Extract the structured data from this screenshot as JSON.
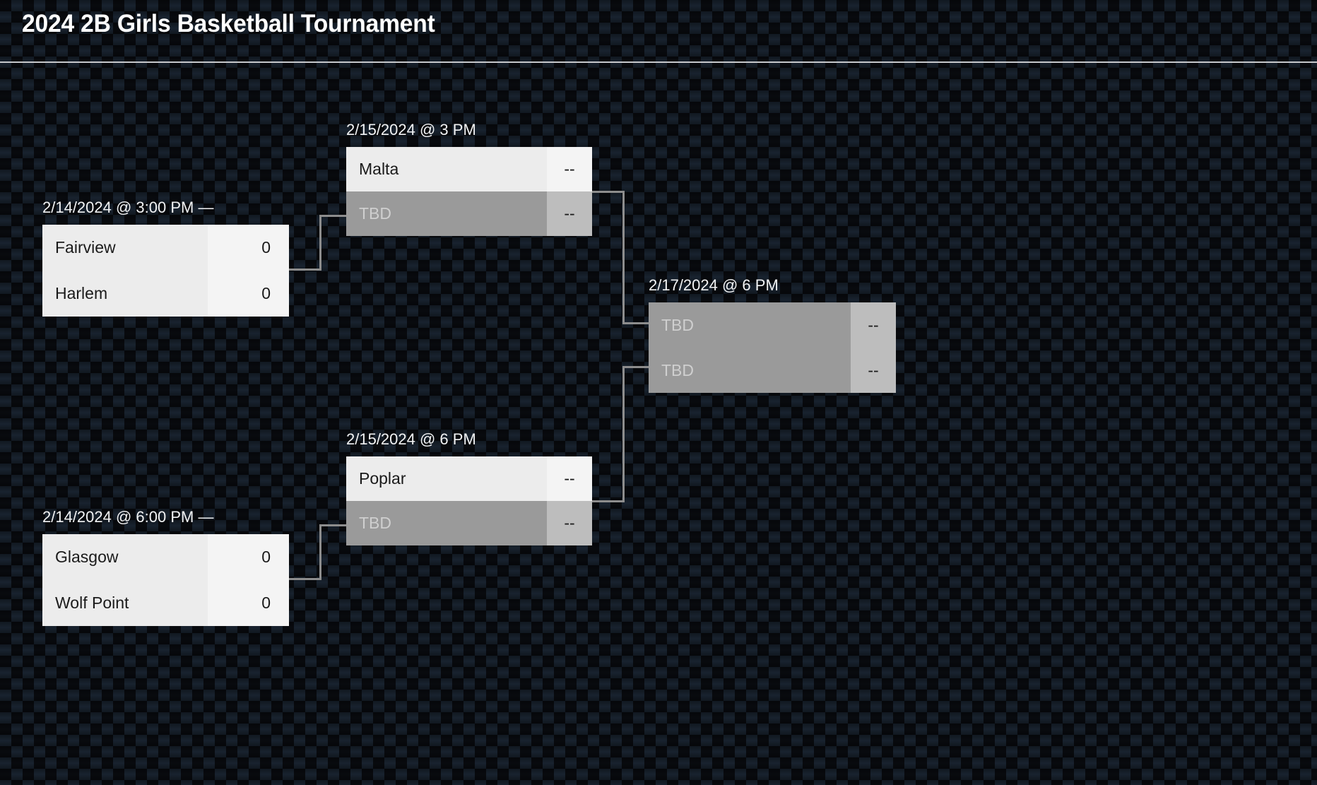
{
  "header": {
    "title": "2024 2B Girls Basketball Tournament"
  },
  "colors": {
    "background": "#080a0e",
    "background_check": "#18222e",
    "rule": "#c6c8cb",
    "row_open_name_bg": "#ececec",
    "row_open_score_bg": "#f4f4f4",
    "row_tbd_name_bg": "#9a9a9a",
    "row_tbd_score_bg": "#bdbdbd",
    "tbd_text": "#cfcfcf",
    "text_dark": "#1a1a1a",
    "date_text": "#f2f3f4",
    "connector": "#8d8d8d"
  },
  "bracket": {
    "rounds": [
      {
        "name": "round-1",
        "matches": [
          {
            "id": "r1-m1",
            "date": "2/14/2024 @ 3:00 PM —",
            "teams": [
              {
                "name": "Fairview",
                "score": "0",
                "tbd": false
              },
              {
                "name": "Harlem",
                "score": "0",
                "tbd": false
              }
            ]
          },
          {
            "id": "r1-m2",
            "date": "2/14/2024 @ 6:00 PM —",
            "teams": [
              {
                "name": "Glasgow",
                "score": "0",
                "tbd": false
              },
              {
                "name": "Wolf Point",
                "score": "0",
                "tbd": false
              }
            ]
          }
        ]
      },
      {
        "name": "round-2",
        "matches": [
          {
            "id": "r2-m1",
            "date": "2/15/2024 @ 3 PM",
            "teams": [
              {
                "name": "Malta",
                "score": "--",
                "tbd": false
              },
              {
                "name": "TBD",
                "score": "--",
                "tbd": true
              }
            ]
          },
          {
            "id": "r2-m2",
            "date": "2/15/2024 @ 6 PM",
            "teams": [
              {
                "name": "Poplar",
                "score": "--",
                "tbd": false
              },
              {
                "name": "TBD",
                "score": "--",
                "tbd": true
              }
            ]
          }
        ]
      },
      {
        "name": "final",
        "matches": [
          {
            "id": "f-m1",
            "date": "2/17/2024 @ 6 PM",
            "teams": [
              {
                "name": "TBD",
                "score": "--",
                "tbd": true
              },
              {
                "name": "TBD",
                "score": "--",
                "tbd": true
              }
            ]
          }
        ]
      }
    ]
  }
}
